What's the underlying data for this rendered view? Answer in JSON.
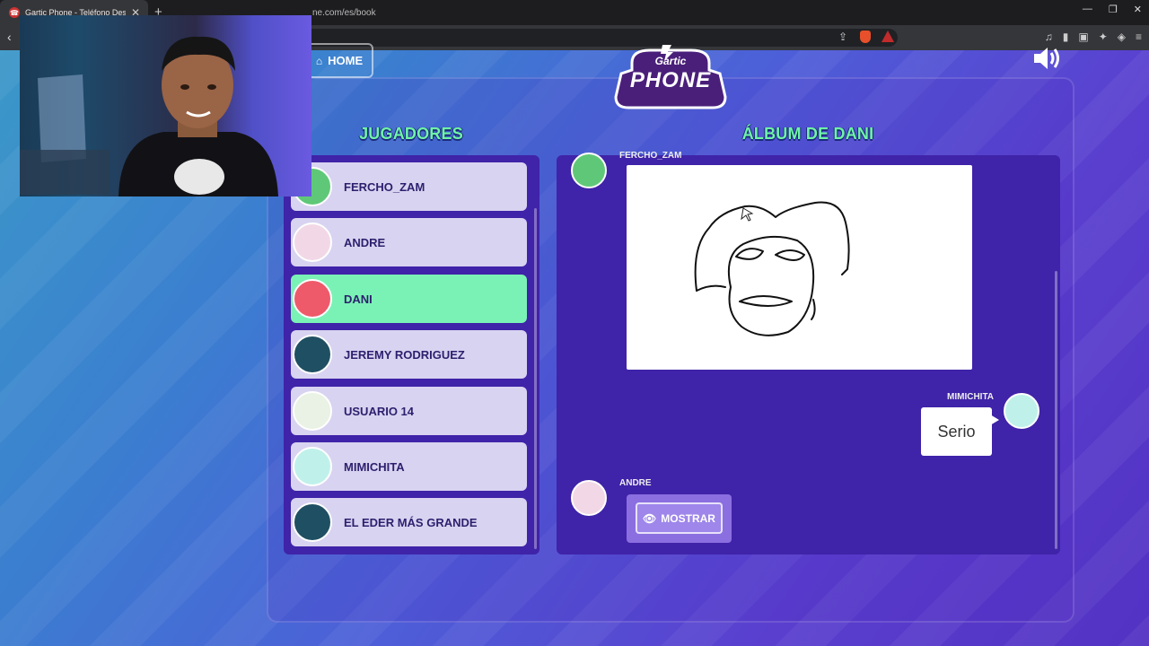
{
  "browser": {
    "tab_title": "Gartic Phone - Teléfono Descom",
    "tab_favicon": "☎",
    "tab_close": "✕",
    "new_tab": "+",
    "url": "ne.com/es/book",
    "window_buttons": [
      "—",
      "❐",
      "✕"
    ]
  },
  "game": {
    "home_label": "HOME",
    "logo_top": "Gartic",
    "logo_main": "PHONE",
    "players_heading": "JUGADORES",
    "album_heading": "ÁLBUM DE DANI",
    "players": [
      {
        "name": "FERCHO_ZAM",
        "active": false,
        "avatar_color": "#5fc878"
      },
      {
        "name": "ANDRE",
        "active": false,
        "avatar_color": "#f2d8e6"
      },
      {
        "name": "DANI",
        "active": true,
        "avatar_color": "#ee5a6a"
      },
      {
        "name": "JEREMY RODRIGUEZ",
        "active": false,
        "avatar_color": "#1f4f62"
      },
      {
        "name": "USUARIO 14",
        "active": false,
        "avatar_color": "#e9f2e4"
      },
      {
        "name": "MIMICHITA",
        "active": false,
        "avatar_color": "#bff1ea"
      },
      {
        "name": "EL EDER MÁS GRANDE",
        "active": false,
        "avatar_color": "#1f4f62"
      }
    ],
    "album": {
      "drawing_author": "FERCHO_ZAM",
      "text_author": "MIMICHITA",
      "text_message": "Serio",
      "pending_author": "ANDRE",
      "show_label": "MOSTRAR"
    }
  },
  "colors": {
    "accent_green": "#6ff5a7",
    "panel_purple": "#3f23a8"
  }
}
